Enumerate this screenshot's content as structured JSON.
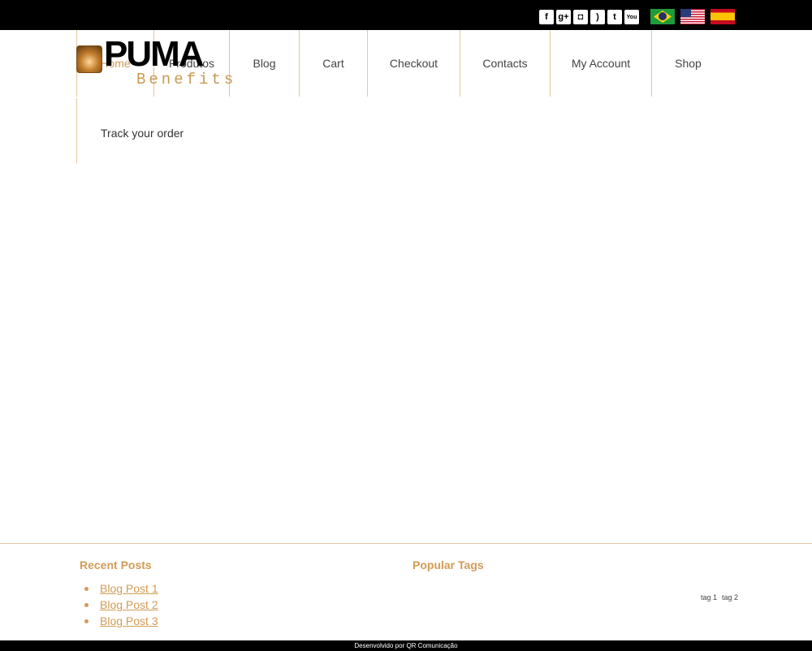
{
  "social": {
    "icons": [
      "facebook-icon",
      "google-plus-icon",
      "instagram-icon",
      "rss-icon",
      "twitter-icon",
      "youtube-icon"
    ],
    "glyphs": [
      "f",
      "g+",
      "◘",
      ")",
      "t",
      "You"
    ]
  },
  "languages": [
    "flag-brazil",
    "flag-usa",
    "flag-spain"
  ],
  "logo": {
    "word": "PUMA",
    "sub": "Benefits"
  },
  "nav": {
    "items": [
      "Home",
      "Produtos",
      "Blog",
      "Cart",
      "Checkout",
      "Contacts",
      "My Account",
      "Shop"
    ]
  },
  "page": {
    "title": "Track your order"
  },
  "footer": {
    "recent_title": "Recent Posts",
    "recent_posts": [
      "Blog Post 1",
      "Blog Post 2",
      "Blog Post 3"
    ],
    "tags_title": "Popular Tags",
    "tags": [
      "tag 1",
      "tag 2"
    ],
    "credit": "Desenvolvido por QR Comunicação"
  },
  "colors": {
    "accent": "#d29b55",
    "divider": "#e2c79e",
    "bar": "#000000"
  }
}
